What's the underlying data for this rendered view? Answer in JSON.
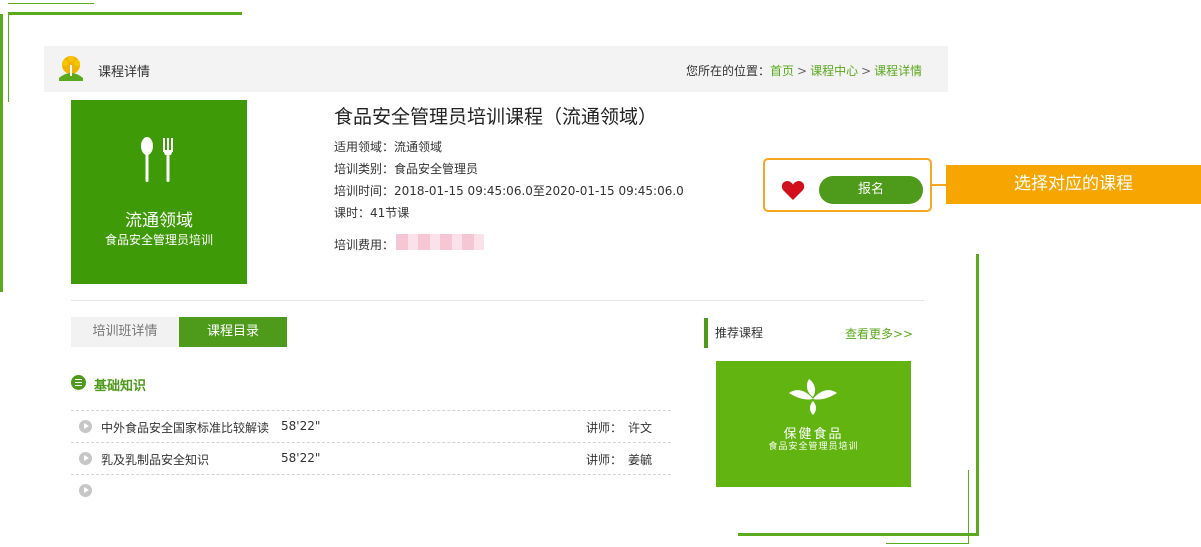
{
  "header": {
    "title": "课程详情",
    "breadcrumb": {
      "prefix": "您所在的位置：",
      "items": [
        "首页",
        "课程中心",
        "课程详情"
      ],
      "separator": ">"
    }
  },
  "course_image": {
    "title": "流通领域",
    "subtitle": "食品安全管理员培训"
  },
  "course": {
    "title": "食品安全管理员培训课程（流通领域）",
    "field": "适用领域：流通领域",
    "category": "培训类别：食品安全管理员",
    "time": "培训时间：2018-01-15 09:45:06.0至2020-01-15 09:45:06.0",
    "hours": "课时：41节课",
    "fee_label": "培训费用："
  },
  "enroll": {
    "button_label": "报名"
  },
  "callout": {
    "text": "选择对应的课程"
  },
  "tabs": [
    {
      "label": "培训班详情",
      "active": false
    },
    {
      "label": "课程目录",
      "active": true
    }
  ],
  "catalog": {
    "section_title": "基础知识",
    "teacher_label": "讲师：",
    "lessons": [
      {
        "name": "中外食品安全国家标准比较解读",
        "duration": "58'22\"",
        "teacher": "许文"
      },
      {
        "name": "乳及乳制品安全知识",
        "duration": "58'22\"",
        "teacher": "姜毓"
      }
    ]
  },
  "recommended": {
    "title": "推荐课程",
    "more": "查看更多>>",
    "card": {
      "title": "保健食品",
      "subtitle": "食品安全管理员培训"
    }
  },
  "colors": {
    "brand_green": "#4e9a1a",
    "callout_orange": "#f7a500",
    "highlight_border": "#f5a623",
    "heart_red": "#d0111b"
  }
}
